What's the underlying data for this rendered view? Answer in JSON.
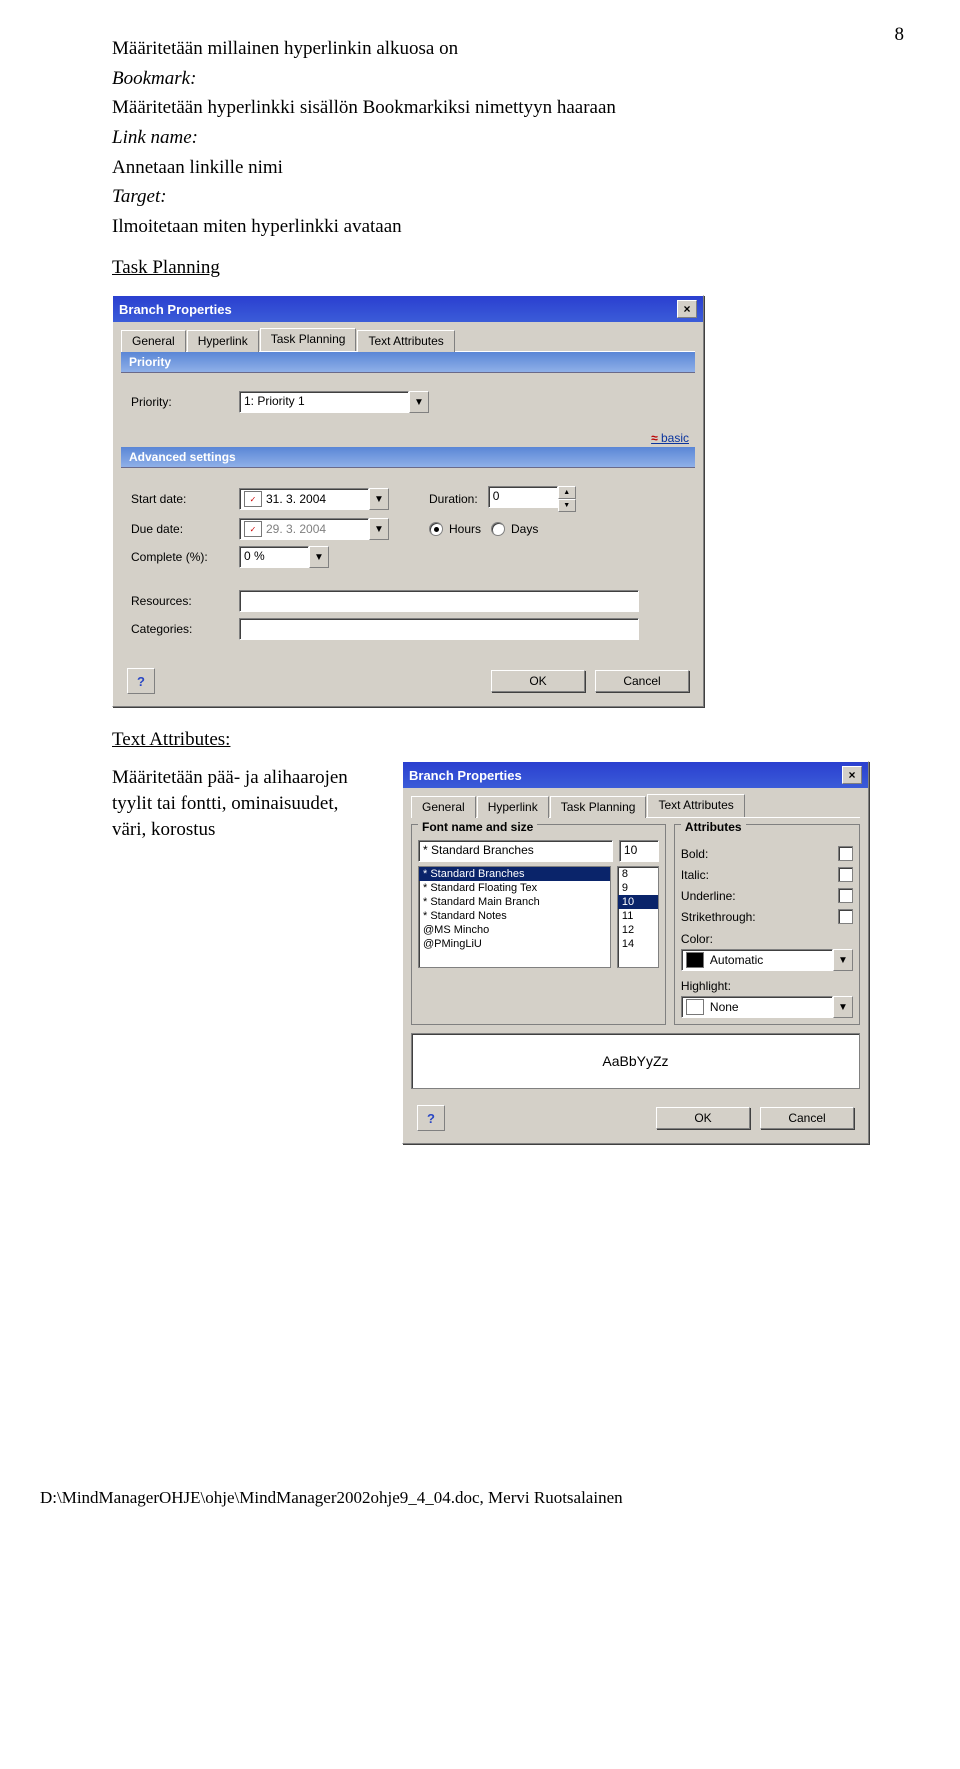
{
  "page_number": "8",
  "body": {
    "p1": "Määritetään millainen hyperlinkin alkuosa on",
    "p2": "Bookmark:",
    "p3": "Määritetään hyperlinkki sisällön Bookmarkiksi nimettyyn haaraan",
    "p4": "Link name:",
    "p5": "Annetaan linkille nimi",
    "p6": "Target:",
    "p7": "Ilmoitetaan miten hyperlinkki avataan",
    "h1": "Task Planning",
    "h2": "Text Attributes:",
    "copy1": "Määritetään pää- ja alihaarojen tyylit tai fontti, ominaisuudet, väri, korostus"
  },
  "dialog1": {
    "title": "Branch Properties",
    "tabs": [
      "General",
      "Hyperlink",
      "Task Planning",
      "Text Attributes"
    ],
    "active_tab": 2,
    "groups": {
      "priority": {
        "label": "Priority",
        "fields": {
          "priority_label": "Priority:",
          "priority_value": "1: Priority 1"
        }
      },
      "basic_link": "basic",
      "advanced": {
        "label": "Advanced settings",
        "start_label": "Start date:",
        "start_value": "31. 3. 2004",
        "due_label": "Due date:",
        "due_value": "29. 3. 2004",
        "duration_label": "Duration:",
        "duration_value": "0",
        "hours": "Hours",
        "days": "Days",
        "complete_label": "Complete (%):",
        "complete_value": "0 %",
        "resources_label": "Resources:",
        "categories_label": "Categories:"
      }
    },
    "buttons": {
      "ok": "OK",
      "cancel": "Cancel"
    }
  },
  "dialog2": {
    "title": "Branch Properties",
    "tabs": [
      "General",
      "Hyperlink",
      "Task Planning",
      "Text Attributes"
    ],
    "active_tab": 3,
    "font_panel_title": "Font name and size",
    "attr_panel_title": "Attributes",
    "font_selected_name": "* Standard Branches",
    "font_selected_size": "10",
    "font_list": [
      "* Standard Branches",
      "* Standard Floating Tex",
      "* Standard Main Branch",
      "* Standard Notes",
      "@MS Mincho",
      "@PMingLiU"
    ],
    "size_list": [
      "8",
      "9",
      "10",
      "11",
      "12",
      "14"
    ],
    "attrs": {
      "bold": "Bold:",
      "italic": "Italic:",
      "underline": "Underline:",
      "strike": "Strikethrough:",
      "color": "Color:",
      "color_value": "Automatic",
      "highlight": "Highlight:",
      "highlight_value": "None"
    },
    "preview": "AaBbYyZz",
    "buttons": {
      "ok": "OK",
      "cancel": "Cancel"
    }
  },
  "footer": "D:\\MindManagerOHJE\\ohje\\MindManager2002ohje9_4_04.doc, Mervi Ruotsalainen"
}
